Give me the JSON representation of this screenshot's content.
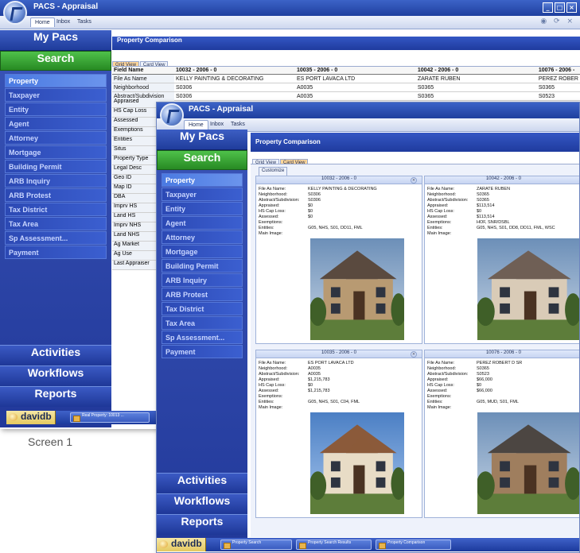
{
  "screen1": {
    "title": "PACS - Appraisal",
    "menu_tabs": [
      "Home",
      "Inbox",
      "Tasks"
    ],
    "nav_header": "My Pacs",
    "nav_search": "Search",
    "nav_items": [
      "Property",
      "Taxpayer",
      "Entity",
      "Agent",
      "Attorney",
      "Mortgage",
      "Building Permit",
      "ARB Inquiry",
      "ARB Protest",
      "Tax District",
      "Tax Area",
      "Sp Assessment...",
      "Payment"
    ],
    "nav_bottom": [
      "Activities",
      "Workflows",
      "Reports"
    ],
    "content_title": "Property Comparison",
    "view_tabs": [
      "Grid View",
      "Card View"
    ],
    "grid": {
      "columns": [
        "Field Name",
        "10032 - 2006 - 0",
        "10035 - 2006 - 0",
        "10042 - 2006 - 0",
        "10076 - 2006 -"
      ],
      "rows": [
        [
          "File As Name",
          "KELLY PAINTING & DECORATING",
          "ES PORT LAVACA LTD",
          "ZARATE RUBEN",
          "PEREZ ROBER"
        ],
        [
          "Neighborhood",
          "S0306",
          "A0035",
          "S0365",
          "S0365"
        ],
        [
          "Abstract/Subdivision",
          "S0306",
          "A0035",
          "S0365",
          "S0523"
        ]
      ],
      "field_names": [
        "Appraised",
        "HS Cap Loss",
        "Assessed",
        "Exemptions",
        "Entities",
        "Situs",
        "Property Type",
        "Legal Desc",
        "Geo ID",
        "Map ID",
        "DBA",
        "Imprv HS",
        "Land HS",
        "Imprv NHS",
        "Land NHS",
        "Ag Market",
        "Ag Use",
        "Last Appraiser"
      ]
    },
    "taskbar_user": "davidb",
    "taskbar_item": "Real Property: 10013 ...",
    "caption": "Screen 1"
  },
  "screen2": {
    "title": "PACS - Appraisal",
    "menu_tabs": [
      "Home",
      "Inbox",
      "Tasks"
    ],
    "nav_header": "My Pacs",
    "nav_search": "Search",
    "nav_items": [
      "Property",
      "Taxpayer",
      "Entity",
      "Agent",
      "Attorney",
      "Mortgage",
      "Building Permit",
      "ARB Inquiry",
      "ARB Protest",
      "Tax District",
      "Tax Area",
      "Sp Assessment...",
      "Payment"
    ],
    "nav_bottom": [
      "Activities",
      "Workflows",
      "Reports"
    ],
    "content_title": "Property Comparison",
    "view_tabs": [
      "Grid View",
      "Card View"
    ],
    "customize_label": "Customize",
    "card_labels": [
      "File As Name:",
      "Neighborhood:",
      "Abstract/Subdivision:",
      "Appraised:",
      "HS Cap Loss:",
      "Assessed:",
      "Exemptions:",
      "Entities:",
      "Main Image:"
    ],
    "cards": [
      {
        "title": "10032 - 2006 - 0",
        "values": [
          "KELLY PAINTING & DECORATING",
          "S0306",
          "S0306",
          "$0",
          "$0",
          "$0",
          "",
          "G05, NHS, S01, DD11, FML"
        ]
      },
      {
        "title": "10042 - 2006 - 0",
        "values": [
          "ZARATE RUBEN",
          "S0365",
          "S0365",
          "$113,514",
          "$0",
          "$113,514",
          "HOF, SNR/DSBL",
          "G05, NHS, S01, DD8, DD11, FML, WSC"
        ]
      },
      {
        "title": "10035 - 2006 - 0",
        "values": [
          "ES PORT LAVACA LTD",
          "A0035",
          "A0035",
          "$1,215,783",
          "$0",
          "$1,215,783",
          "",
          "G05, NHS, S01, C04, FML"
        ]
      },
      {
        "title": "10076 - 2006 - 0",
        "values": [
          "PEREZ ROBERT D SR",
          "S0365",
          "S0523",
          "$66,000",
          "$0",
          "$66,000",
          "",
          "G05, MUD, S01, FML"
        ]
      }
    ],
    "taskbar_user": "davidb",
    "taskbar_items": [
      "Property Search",
      "Property Search Results",
      "Property Comparison"
    ]
  }
}
